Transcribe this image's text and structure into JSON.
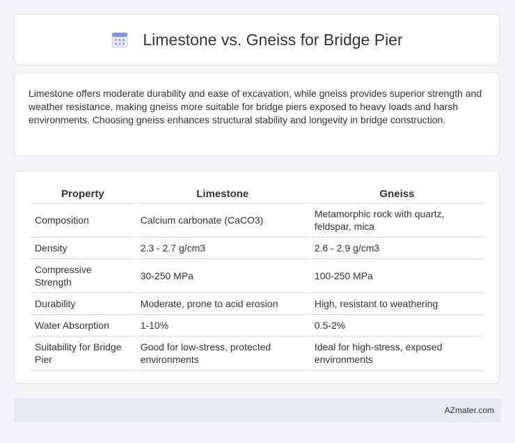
{
  "header": {
    "title": "Limestone vs. Gneiss for Bridge Pier",
    "icon": "calendar-icon"
  },
  "intro": {
    "text": "Limestone offers moderate durability and ease of excavation, while gneiss provides superior strength and weather resistance, making gneiss more suitable for bridge piers exposed to heavy loads and harsh environments. Choosing gneiss enhances structural stability and longevity in bridge construction."
  },
  "table": {
    "headers": [
      "Property",
      "Limestone",
      "Gneiss"
    ],
    "rows": [
      [
        "Composition",
        "Calcium carbonate (CaCO3)",
        "Metamorphic rock with quartz, feldspar, mica"
      ],
      [
        "Density",
        "2.3 - 2.7 g/cm3",
        "2.6 - 2.9 g/cm3"
      ],
      [
        "Compressive Strength",
        "30-250 MPa",
        "100-250 MPa"
      ],
      [
        "Durability",
        "Moderate, prone to acid erosion",
        "High, resistant to weathering"
      ],
      [
        "Water Absorption",
        "1-10%",
        "0.5-2%"
      ],
      [
        "Suitability for Bridge Pier",
        "Good for low-stress, protected environments",
        "Ideal for high-stress, exposed environments"
      ]
    ]
  },
  "footer": {
    "brand": "AZmater.com"
  }
}
